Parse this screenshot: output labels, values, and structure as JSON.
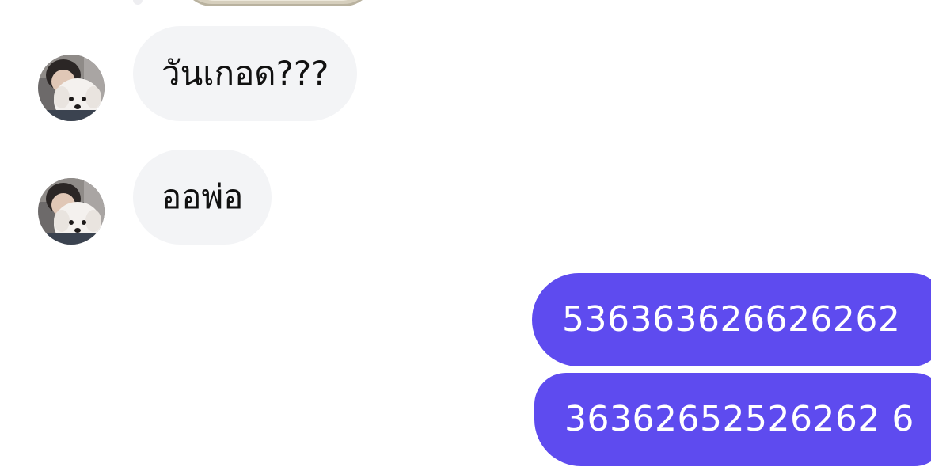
{
  "conversation": {
    "incoming": [
      {
        "text": "วันเกอด???",
        "sender_avatar": "user-avatar-with-white-dog"
      },
      {
        "text": "ออพ่อ",
        "sender_avatar": "user-avatar-with-white-dog"
      }
    ],
    "outgoing": [
      {
        "text": "536363626626262"
      },
      {
        "text": "36362652526262 6"
      }
    ]
  },
  "colors": {
    "incoming_bubble": "#f3f4f6",
    "outgoing_bubble": "#5e4bef",
    "incoming_text": "#111111",
    "outgoing_text": "#ffffff",
    "background": "#ffffff"
  }
}
